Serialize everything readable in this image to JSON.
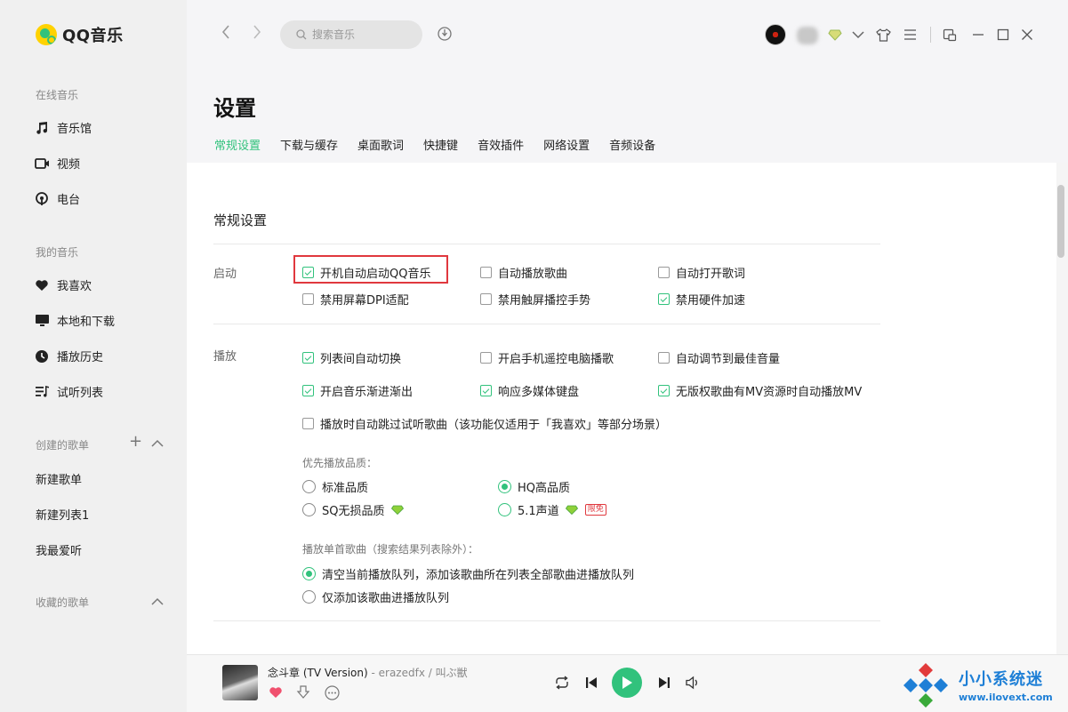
{
  "app": {
    "name": "QQ音乐"
  },
  "sidebar": {
    "online_title": "在线音乐",
    "online_items": [
      {
        "label": "音乐馆",
        "icon": "music-note-icon"
      },
      {
        "label": "视频",
        "icon": "video-icon"
      },
      {
        "label": "电台",
        "icon": "radio-icon"
      }
    ],
    "mine_title": "我的音乐",
    "mine_items": [
      {
        "label": "我喜欢",
        "icon": "heart-icon"
      },
      {
        "label": "本地和下载",
        "icon": "monitor-icon"
      },
      {
        "label": "播放历史",
        "icon": "history-icon"
      },
      {
        "label": "试听列表",
        "icon": "playlist-icon"
      }
    ],
    "created_title": "创建的歌单",
    "created_playlists": [
      "新建歌单",
      "新建列表1",
      "我最爱听"
    ],
    "collected_title": "收藏的歌单"
  },
  "search": {
    "placeholder": "搜索音乐"
  },
  "page": {
    "title": "设置",
    "tabs": [
      "常规设置",
      "下载与缓存",
      "桌面歌词",
      "快捷键",
      "音效插件",
      "网络设置",
      "音频设备"
    ],
    "active_tab": "常规设置"
  },
  "settings": {
    "section_title": "常规设置",
    "startup": {
      "label": "启动",
      "options": [
        {
          "label": "开机自动启动QQ音乐",
          "checked": true
        },
        {
          "label": "自动播放歌曲",
          "checked": false
        },
        {
          "label": "自动打开歌词",
          "checked": false
        },
        {
          "label": "禁用屏幕DPI适配",
          "checked": false
        },
        {
          "label": "禁用触屏播控手势",
          "checked": false
        },
        {
          "label": "禁用硬件加速",
          "checked": true
        }
      ]
    },
    "playback": {
      "label": "播放",
      "options": [
        {
          "label": "列表间自动切换",
          "checked": true
        },
        {
          "label": "开启手机遥控电脑播歌",
          "checked": false
        },
        {
          "label": "自动调节到最佳音量",
          "checked": false
        },
        {
          "label": "开启音乐渐进渐出",
          "checked": true
        },
        {
          "label": "响应多媒体键盘",
          "checked": true
        },
        {
          "label": "无版权歌曲有MV资源时自动播放MV",
          "checked": true
        },
        {
          "label": "播放时自动跳过试听歌曲（该功能仅适用于「我喜欢」等部分场景）",
          "checked": false
        }
      ],
      "quality_title": "优先播放品质：",
      "quality_options": [
        {
          "label": "标准品质",
          "selected": false
        },
        {
          "label": "HQ高品质",
          "selected": true
        },
        {
          "label": "SQ无损品质",
          "selected": false
        },
        {
          "label": "5.1声道",
          "selected": false
        }
      ],
      "limited_badge": "限免",
      "single_title": "播放单首歌曲（搜索结果列表除外）：",
      "single_options": [
        {
          "label": "清空当前播放队列，添加该歌曲所在列表全部歌曲进播放队列",
          "selected": true
        },
        {
          "label": "仅添加该歌曲进播放队列",
          "selected": false
        }
      ]
    }
  },
  "player": {
    "song_title": "念斗章 (TV Version)",
    "artist": " - erazedfx / 叫ぶ獣"
  },
  "watermark": {
    "text": "小小系统迷",
    "url": "www.ilovext.com"
  },
  "colors": {
    "accent": "#31c27c",
    "highlight": "#e0383e",
    "watermark": "#1e7fd6"
  }
}
